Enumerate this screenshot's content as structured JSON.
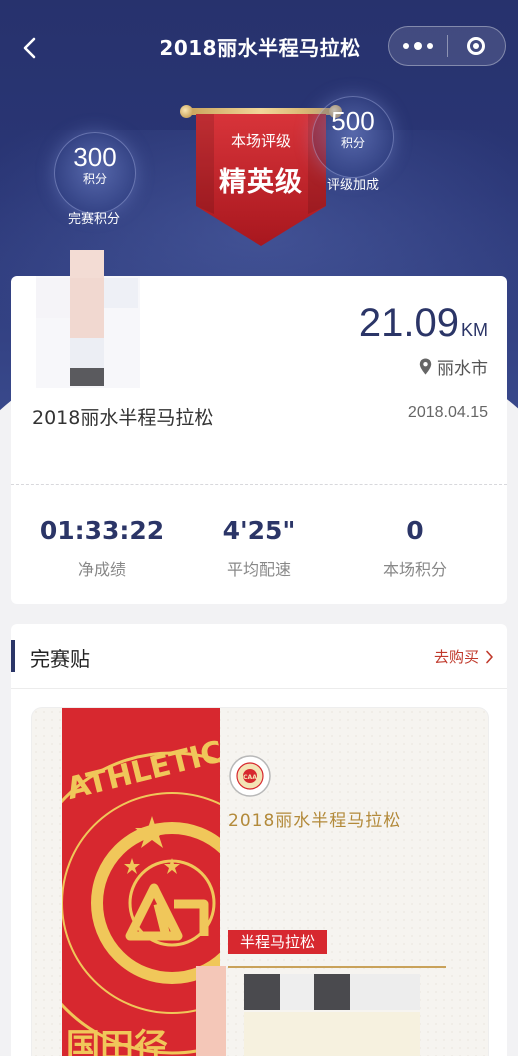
{
  "nav": {
    "title": "2018丽水半程马拉松",
    "back_icon": "chevron-left-icon",
    "more_icon": "more-dots-icon",
    "close_icon": "target-close-icon"
  },
  "badges": {
    "finish_points": {
      "value": "300",
      "unit": "积分",
      "caption": "完赛积分"
    },
    "rating": {
      "label": "本场评级",
      "value": "精英级"
    },
    "bonus_points": {
      "value": "500",
      "unit": "积分",
      "caption": "评级加成"
    }
  },
  "race": {
    "distance": "21.09",
    "distance_unit": "KM",
    "location": "丽水市",
    "name": "2018丽水半程马拉松",
    "date": "2018.04.15"
  },
  "stats": [
    {
      "value": "01:33:22",
      "label": "净成绩"
    },
    {
      "value": "4'25\"",
      "label": "平均配速"
    },
    {
      "value": "0",
      "label": "本场积分"
    }
  ],
  "certificate_section": {
    "title": "完赛贴",
    "buy_link": "去购买",
    "card": {
      "red_band_text": "ATHLETICS",
      "logo_text": "CAA",
      "title": "2018丽水半程马拉松",
      "tag": "半程马拉松"
    }
  },
  "colors": {
    "header_navy": "#27326d",
    "accent_navy": "#2b3567",
    "banner_red": "#c8252c",
    "gold": "#c9a25a",
    "link_red": "#c0392b"
  }
}
